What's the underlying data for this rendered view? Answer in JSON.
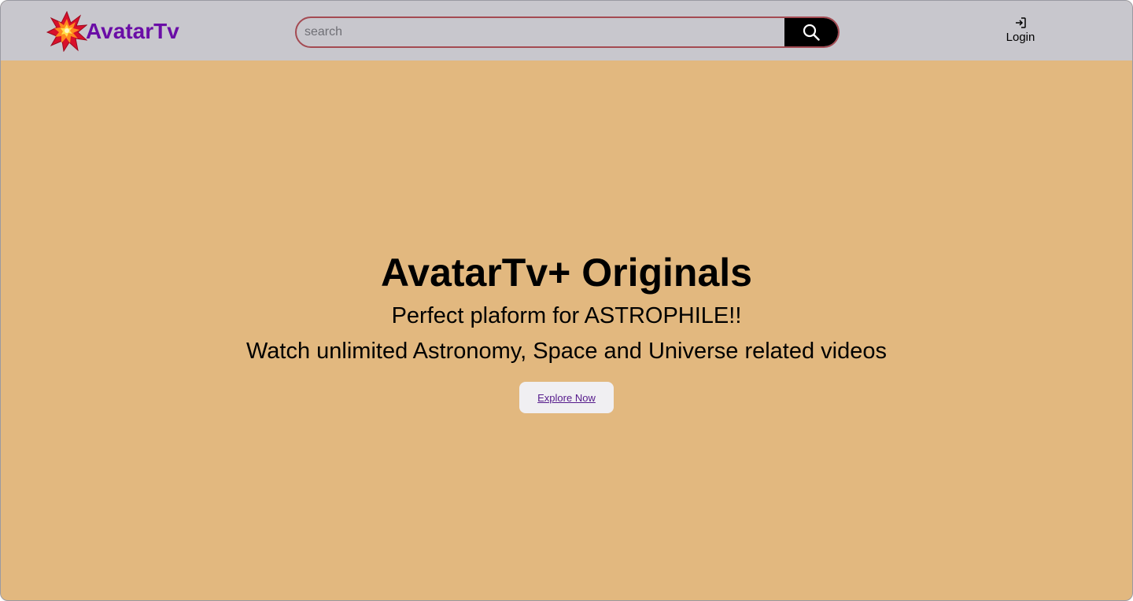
{
  "header": {
    "brand_name": "AvatarTv",
    "logo_icon": "star-burst-icon",
    "search": {
      "placeholder": "search",
      "value": "",
      "button_icon": "search-icon"
    },
    "login": {
      "icon": "login-icon",
      "label": "Login"
    }
  },
  "hero": {
    "title": "AvatarTv+ Originals",
    "subtitle": "Perfect plaform for ASTROPHILE!!",
    "tagline": "Watch unlimited Astronomy, Space and Universe related videos",
    "cta_label": "Explore Now"
  },
  "colors": {
    "navbar_bg": "#c8c7cd",
    "page_bg": "#e2b87f",
    "brand_text": "#6a0da6",
    "search_border": "#a44a52",
    "search_button_bg": "#000000",
    "cta_bg": "#f0eff2",
    "cta_text": "#551a8b"
  }
}
